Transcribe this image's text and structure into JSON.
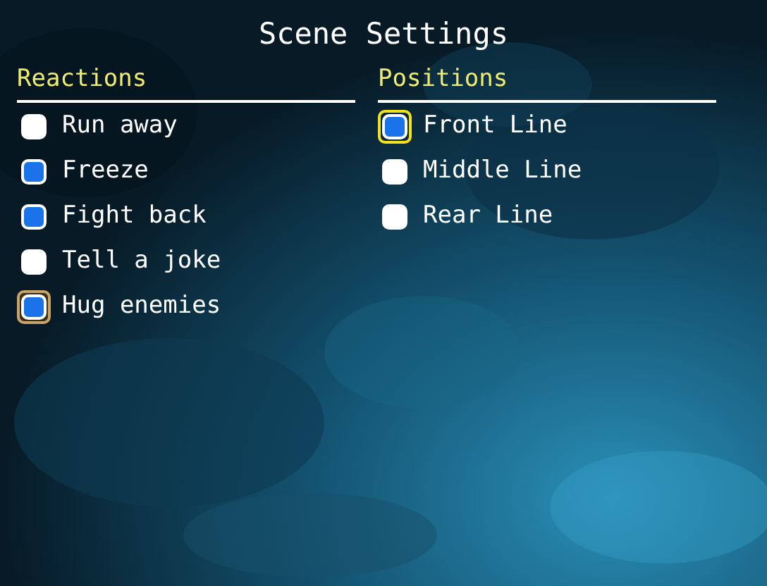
{
  "title": "Scene Settings",
  "groups": [
    {
      "heading": "Reactions",
      "options": [
        {
          "label": "Run away",
          "checked": false,
          "focused": false,
          "hovered": false
        },
        {
          "label": "Freeze",
          "checked": true,
          "focused": false,
          "hovered": false
        },
        {
          "label": "Fight back",
          "checked": true,
          "focused": false,
          "hovered": false
        },
        {
          "label": "Tell a joke",
          "checked": false,
          "focused": false,
          "hovered": false
        },
        {
          "label": "Hug enemies",
          "checked": true,
          "focused": false,
          "hovered": true
        }
      ]
    },
    {
      "heading": "Positions",
      "options": [
        {
          "label": "Front Line",
          "checked": true,
          "focused": true,
          "hovered": false
        },
        {
          "label": "Middle Line",
          "checked": false,
          "focused": false,
          "hovered": false
        },
        {
          "label": "Rear Line",
          "checked": false,
          "focused": false,
          "hovered": false
        }
      ]
    }
  ]
}
